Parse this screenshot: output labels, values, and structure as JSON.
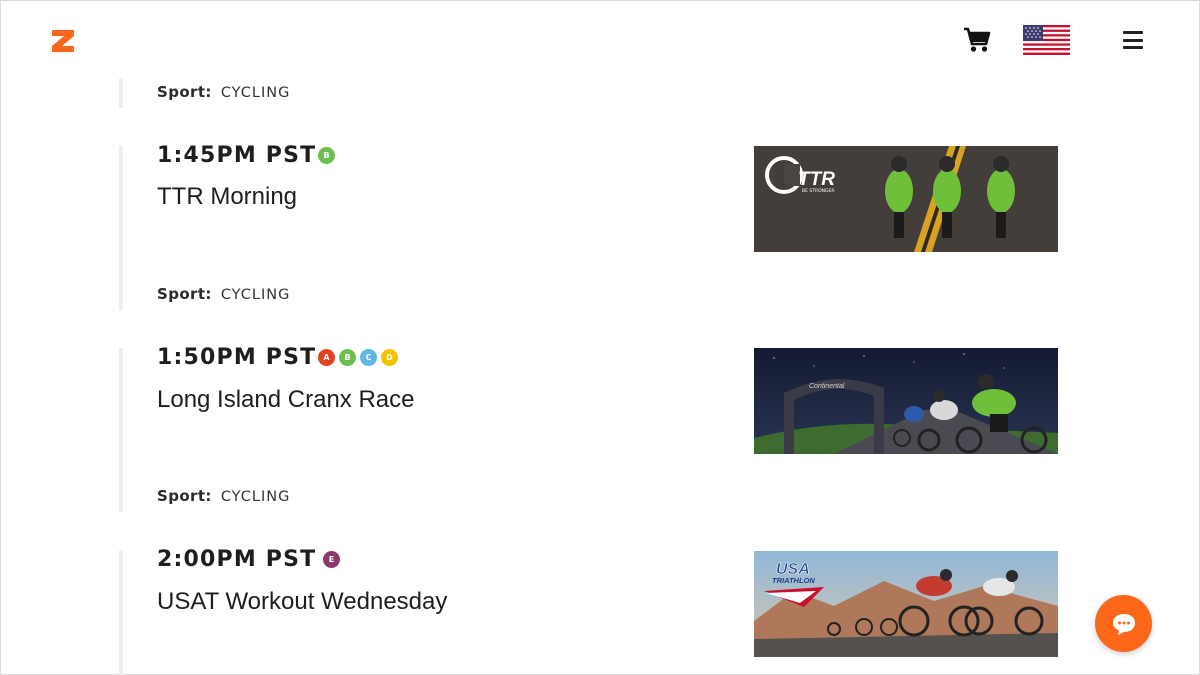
{
  "header": {
    "logo_icon": "zwift-z-logo",
    "cart_icon": "cart-icon",
    "flag_icon": "us-flag-icon",
    "menu_icon": "hamburger-menu-icon",
    "brand_color": "#fc6719"
  },
  "events": [
    {
      "sport_label": "Sport:",
      "sport": "CYCLING"
    },
    {
      "time": "1:45PM PST",
      "categories": [
        {
          "label": "B",
          "color": "#6bbf4e"
        }
      ],
      "title": "TTR Morning",
      "sport_label": "Sport:",
      "sport": "CYCLING",
      "thumbnail_logo": "TTR",
      "thumbnail_tagline": "BE STRONGER"
    },
    {
      "time": "1:50PM PST",
      "categories": [
        {
          "label": "A",
          "color": "#e2431e"
        },
        {
          "label": "B",
          "color": "#6bbf4e"
        },
        {
          "label": "C",
          "color": "#5db7e8"
        },
        {
          "label": "D",
          "color": "#f3c300"
        }
      ],
      "title": "Long Island Cranx Race",
      "sport_label": "Sport:",
      "sport": "CYCLING",
      "thumbnail_banner": "Continental"
    },
    {
      "time": "2:00PM PST",
      "categories": [
        {
          "label": "E",
          "color": "#8a3a6e"
        }
      ],
      "title": "USAT Workout Wednesday",
      "thumbnail_logo_1": "USA",
      "thumbnail_logo_2": "TRIATHLON"
    }
  ],
  "chat": {
    "icon": "chat-bubble-icon"
  }
}
